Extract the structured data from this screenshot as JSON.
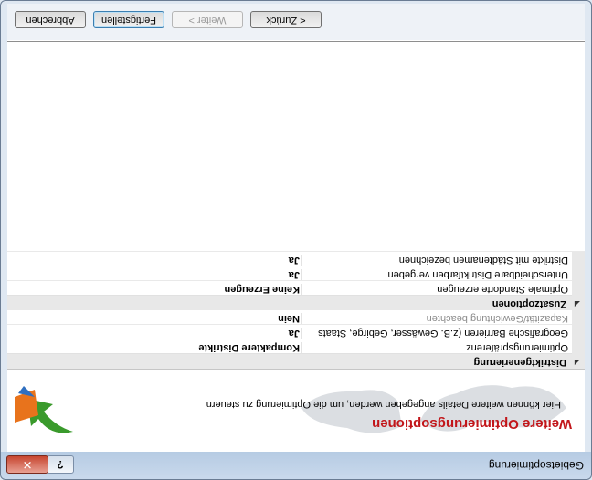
{
  "window": {
    "title": "Gebietsoptimierung",
    "help_glyph": "?",
    "close_glyph": "✕"
  },
  "header": {
    "title": "Weitere Optimierungsoptionen",
    "subtitle": "Hier können weitere Details angegeben werden, um die Optimierung zu steuern"
  },
  "grid": {
    "categories": [
      {
        "label": "Distriktgenerierung",
        "toggle_glyph": "◢",
        "properties": [
          {
            "name": "Optimierungspräferenz",
            "value": "Kompaktere Distrikte",
            "disabled": false
          },
          {
            "name": "Geografische Barrieren (z.B. Gewässer, Gebirge, Staats",
            "value": "Ja",
            "disabled": false
          },
          {
            "name": "Kapazität/Gewichtung beachten",
            "value": "Nein",
            "disabled": true
          }
        ]
      },
      {
        "label": "Zusatzoptionen",
        "toggle_glyph": "◢",
        "properties": [
          {
            "name": "Optimale Standorte erzeugen",
            "value": "Keine Erzeugen",
            "disabled": false
          },
          {
            "name": "Unterscheidbare Distriktfarben vergeben",
            "value": "Ja",
            "disabled": false
          },
          {
            "name": "Distrikte mit Städtenamen bezeichnen",
            "value": "Ja",
            "disabled": false
          }
        ]
      }
    ]
  },
  "buttons": {
    "back": "< Zurück",
    "next": "Weiter >",
    "finish": "Fertigstellen",
    "cancel": "Abbrechen"
  },
  "colors": {
    "title_red": "#c2161a",
    "logo_green": "#3a9a2c",
    "logo_orange": "#e8731c"
  },
  "icons": {
    "logo": "green-orange-arrow-logo",
    "map": "world-map-watermark"
  }
}
